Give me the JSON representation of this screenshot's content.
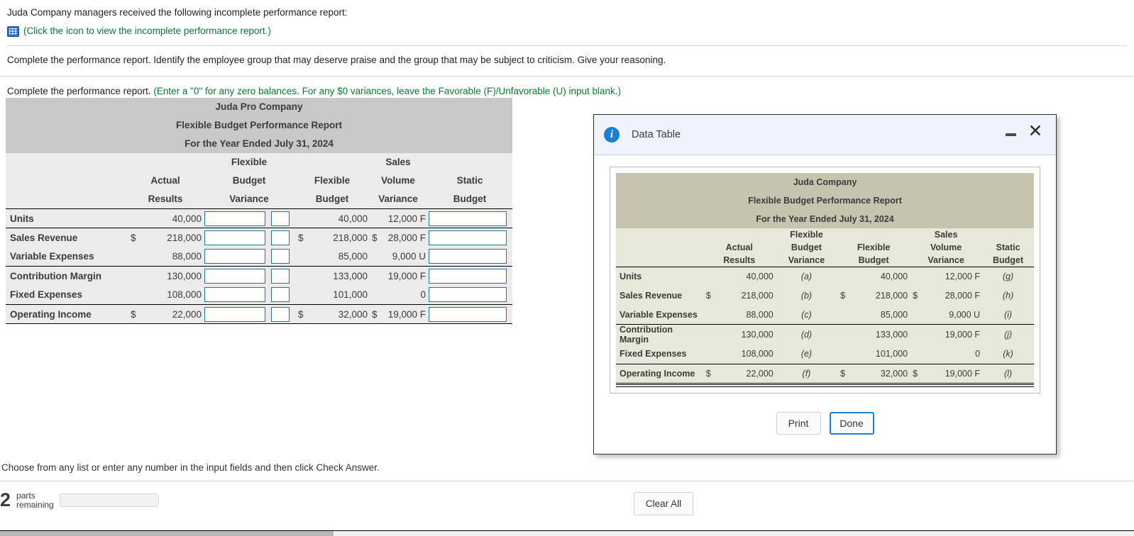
{
  "question": {
    "intro": "Juda Company managers received the following incomplete performance report:",
    "icon_name": "grid-table-icon",
    "icon_link_text": "(Click the icon to view the incomplete performance report.)",
    "task": "Complete the performance report. Identify the employee group that may deserve praise and the group that may be subject to criticism. Give your reasoning.",
    "instruction_black": "Complete the performance report.",
    "instruction_green": "(Enter a \"0\" for any zero balances. For any $0 variances, leave the Favorable (F)/Unfavorable (U) input blank.)"
  },
  "worksheet": {
    "title_lines": [
      "Juda Pro Company",
      "Flexible Budget Performance Report",
      "For the Year Ended July 31, 2024"
    ],
    "headers_top": [
      "",
      "",
      "Flexible",
      "",
      "Sales",
      ""
    ],
    "headers_mid": [
      "",
      "Actual",
      "Budget",
      "Flexible",
      "Volume",
      "Static"
    ],
    "headers_bot": [
      "",
      "Results",
      "Variance",
      "Budget",
      "Variance",
      "Budget"
    ],
    "rows": [
      {
        "label": "Units",
        "actual_dollar": "",
        "actual": "40,000",
        "fbv_input": "",
        "fbv_fu_input": "",
        "flex_dollar": "",
        "flex": "40,000",
        "svv_dollar": "",
        "svv": "12,000 F",
        "static_input": ""
      },
      {
        "label": "Sales Revenue",
        "actual_dollar": "$",
        "actual": "218,000",
        "fbv_input": "",
        "fbv_fu_input": "",
        "flex_dollar": "$",
        "flex": "218,000",
        "svv_dollar": "$",
        "svv": "28,000 F",
        "static_input": ""
      },
      {
        "label": "Variable Expenses",
        "actual_dollar": "",
        "actual": "88,000",
        "fbv_input": "",
        "fbv_fu_input": "",
        "flex_dollar": "",
        "flex": "85,000",
        "svv_dollar": "",
        "svv": "9,000 U",
        "static_input": ""
      },
      {
        "label": "Contribution Margin",
        "actual_dollar": "",
        "actual": "130,000",
        "fbv_input": "",
        "fbv_fu_input": "",
        "flex_dollar": "",
        "flex": "133,000",
        "svv_dollar": "",
        "svv": "19,000 F",
        "static_input": ""
      },
      {
        "label": "Fixed Expenses",
        "actual_dollar": "",
        "actual": "108,000",
        "fbv_input": "",
        "fbv_fu_input": "",
        "flex_dollar": "",
        "flex": "101,000",
        "svv_dollar": "",
        "svv": "0",
        "static_input": ""
      },
      {
        "label": "Operating Income",
        "actual_dollar": "$",
        "actual": "22,000",
        "fbv_input": "",
        "fbv_fu_input": "",
        "flex_dollar": "$",
        "flex": "32,000",
        "svv_dollar": "$",
        "svv": "19,000 F",
        "static_input": ""
      }
    ]
  },
  "dialog": {
    "title": "Data Table",
    "info_icon": "info-icon",
    "minimize_label": "",
    "close_label": "✕",
    "data_table": {
      "title_lines": [
        "Juda Company",
        "Flexible Budget Performance Report",
        "For the Year Ended July 31, 2024"
      ],
      "headers_top": [
        "",
        "",
        "Flexible",
        "",
        "Sales",
        ""
      ],
      "headers_mid": [
        "",
        "Actual",
        "Budget",
        "Flexible",
        "Volume",
        "Static"
      ],
      "headers_bot": [
        "",
        "Results",
        "Variance",
        "Budget",
        "Variance",
        "Budget"
      ],
      "rows": [
        {
          "label": "Units",
          "actual_dollar": "",
          "actual": "40,000",
          "fbv": "(a)",
          "flex_dollar": "",
          "flex": "40,000",
          "svv_dollar": "",
          "svv": "12,000 F",
          "static": "(g)"
        },
        {
          "label": "Sales Revenue",
          "actual_dollar": "$",
          "actual": "218,000",
          "fbv": "(b)",
          "flex_dollar": "$",
          "flex": "218,000",
          "svv_dollar": "$",
          "svv": "28,000 F",
          "static": "(h)"
        },
        {
          "label": "Variable Expenses",
          "actual_dollar": "",
          "actual": "88,000",
          "fbv": "(c)",
          "flex_dollar": "",
          "flex": "85,000",
          "svv_dollar": "",
          "svv": "9,000 U",
          "static": "(i)"
        },
        {
          "label": "Contribution Margin",
          "actual_dollar": "",
          "actual": "130,000",
          "fbv": "(d)",
          "flex_dollar": "",
          "flex": "133,000",
          "svv_dollar": "",
          "svv": "19,000 F",
          "static": "(j)"
        },
        {
          "label": "Fixed Expenses",
          "actual_dollar": "",
          "actual": "108,000",
          "fbv": "(e)",
          "flex_dollar": "",
          "flex": "101,000",
          "svv_dollar": "",
          "svv": "0",
          "static": "(k)"
        },
        {
          "label": "Operating Income",
          "actual_dollar": "$",
          "actual": "22,000",
          "fbv": "(f)",
          "flex_dollar": "$",
          "flex": "32,000",
          "svv_dollar": "$",
          "svv": "19,000 F",
          "static": "(l)"
        }
      ]
    },
    "buttons": {
      "print": "Print",
      "done": "Done"
    }
  },
  "footer": {
    "hint": "Choose from any list or enter any number in the input fields and then click Check Answer.",
    "parts_count": "2",
    "parts_label_1": "parts",
    "parts_label_2": "remaining",
    "progress_percent": 33,
    "clear_all": "Clear All"
  },
  "colors": {
    "accent_blue": "#1b7fd4",
    "green_text": "#0a7a33",
    "sheet_title_bg": "#c8c8c8",
    "sheet_body_bg": "#ebebeb",
    "datatable_title_bg": "#c6c4ae",
    "datatable_body_bg": "#e8e8da",
    "input_border": "#1f7a96"
  }
}
